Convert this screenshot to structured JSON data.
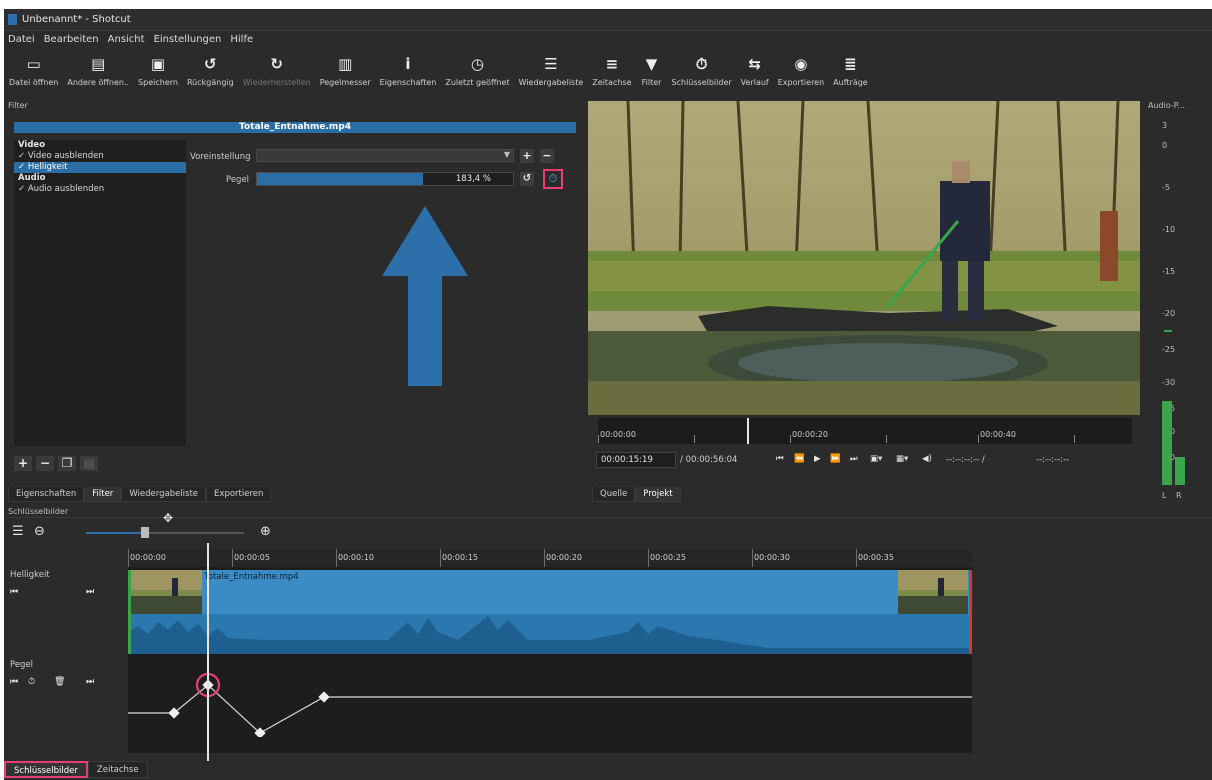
{
  "window": {
    "title": "Unbenannt* - Shotcut"
  },
  "menu": [
    "Datei",
    "Bearbeiten",
    "Ansicht",
    "Einstellungen",
    "Hilfe"
  ],
  "toolbar": [
    {
      "label": "Datei öffnen",
      "icon": "folder-icon"
    },
    {
      "label": "Andere öffnen..",
      "icon": "open-other-icon"
    },
    {
      "label": "Speichern",
      "icon": "save-icon"
    },
    {
      "label": "Rückgängig",
      "icon": "undo-icon"
    },
    {
      "label": "Wiederherstellen",
      "icon": "redo-icon",
      "disabled": true
    },
    {
      "label": "Pegelmesser",
      "icon": "level-meter-icon"
    },
    {
      "label": "Eigenschaften",
      "icon": "info-icon"
    },
    {
      "label": "Zuletzt geöffnet",
      "icon": "clock-icon"
    },
    {
      "label": "Wiedergabeliste",
      "icon": "list-icon"
    },
    {
      "label": "Zeitachse",
      "icon": "timeline-icon"
    },
    {
      "label": "Filter",
      "icon": "filter-icon"
    },
    {
      "label": "Schlüsselbilder",
      "icon": "stopwatch-icon"
    },
    {
      "label": "Verlauf",
      "icon": "history-icon"
    },
    {
      "label": "Exportieren",
      "icon": "export-icon"
    },
    {
      "label": "Aufträge",
      "icon": "jobs-icon"
    }
  ],
  "filter_panel": {
    "title": "Filter",
    "clip_name": "Totale_Entnahme.mp4",
    "list": [
      {
        "text": "Video",
        "type": "head"
      },
      {
        "text": "✓ Video ausblenden",
        "type": "item"
      },
      {
        "text": "✓ Helligkeit",
        "type": "sel"
      },
      {
        "text": "Audio",
        "type": "head"
      },
      {
        "text": "✓ Audio ausblenden",
        "type": "item"
      }
    ],
    "preset_label": "Voreinstellung",
    "preset_value": "",
    "level_label": "Pegel",
    "level_value": "183,4 %",
    "level_fraction": 0.65,
    "arrow_color": "#2c6fa9",
    "highlight_color": "#e83e78"
  },
  "left_tabs": [
    "Eigenschaften",
    "Filter",
    "Wiedergabeliste",
    "Exportieren"
  ],
  "player": {
    "ruler_labels": [
      "00:00:00",
      "00:00:20",
      "00:00:40"
    ],
    "current_time": "00:00:15:19",
    "duration": "/ 00:00:56:04",
    "in_point": "--:--:--:-- /",
    "out_point": "--:--:--:--",
    "tabs": [
      "Quelle",
      "Projekt"
    ]
  },
  "audio_meter": {
    "title": "Audio-P...",
    "scale": [
      "3",
      "0",
      "-5",
      "-10",
      "-15",
      "-20",
      "-25",
      "-30",
      "-35",
      "-40",
      "-50"
    ],
    "channels": [
      "L",
      "R"
    ]
  },
  "keyframes": {
    "title": "Schlüsselbilder",
    "ruler_labels": [
      "00:00:00",
      "00:00:05",
      "00:00:10",
      "00:00:15",
      "00:00:20",
      "00:00:25",
      "00:00:30",
      "00:00:35"
    ],
    "tracks": [
      {
        "name": "Helligkeit",
        "clip": "Totale_Entnahme.mp4"
      },
      {
        "name": "Pegel"
      }
    ]
  },
  "bottom_tabs": [
    "Schlüsselbilder",
    "Zeitachse"
  ]
}
